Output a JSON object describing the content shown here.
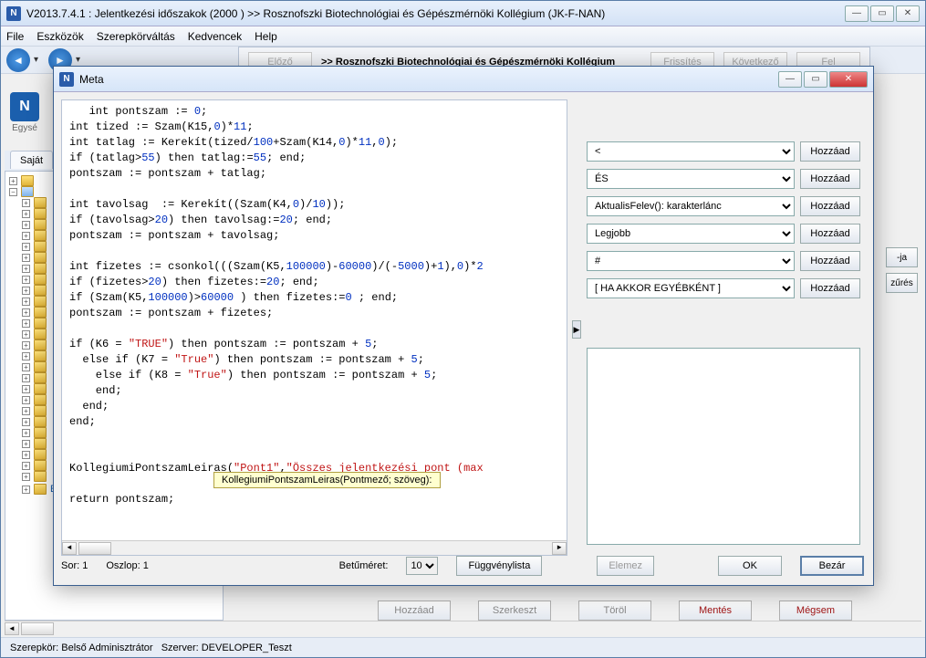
{
  "main": {
    "title": "V2013.7.4.1 : Jelentkezési időszakok (2000  )  >> Rosznofszki Biotechnológiai és Gépészmérnöki Kollégium (JK-F-NAN)",
    "menus": [
      "File",
      "Eszközök",
      "Szerepkörváltás",
      "Kedvencek",
      "Help"
    ],
    "tab": "Saját m",
    "logo_text": "Egysé",
    "mid": {
      "prev": "Előző",
      "text": ">> Rosznofszki Biotechnológiai és Gépészmérnöki Kollégium",
      "refresh": "Frissítés",
      "next": "Következő",
      "up": "Fel"
    },
    "right_btns": [
      "-ja",
      "zűrés"
    ],
    "bottom_btns": {
      "add": "Hozzáad",
      "edit": "Szerkeszt",
      "del": "Töröl",
      "save": "Mentés",
      "cancel": "Mégsem"
    },
    "tree_last": "Elektronikus vizsgák (273700",
    "status": {
      "role_label": "Szerepkör:",
      "role": "Belső Adminisztrátor",
      "server_label": "Szerver:",
      "server": "DEVELOPER_Teszt"
    }
  },
  "dlg": {
    "title": "Meta",
    "status": {
      "sor": "Sor: 1",
      "oszlop": "Oszlop: 1",
      "fontsize_label": "Betűméret:",
      "fontsize": "10",
      "fnlist": "Függvénylista",
      "elemez": "Elemez",
      "ok": "OK",
      "bezar": "Bezár"
    },
    "helpers": {
      "rows": [
        {
          "val": "<",
          "btn": "Hozzáad"
        },
        {
          "val": "ÉS",
          "btn": "Hozzáad"
        },
        {
          "val": "AktualisFelev(): karakterlánc",
          "btn": "Hozzáad"
        },
        {
          "val": "Legjobb",
          "btn": "Hozzáad"
        },
        {
          "val": "#",
          "btn": "Hozzáad"
        },
        {
          "val": "[ HA  AKKOR EGYÉBKÉNT ]",
          "btn": "Hozzáad"
        }
      ]
    },
    "tooltip": "KollegiumiPontszamLeiras(Pontmező; szöveg):"
  }
}
